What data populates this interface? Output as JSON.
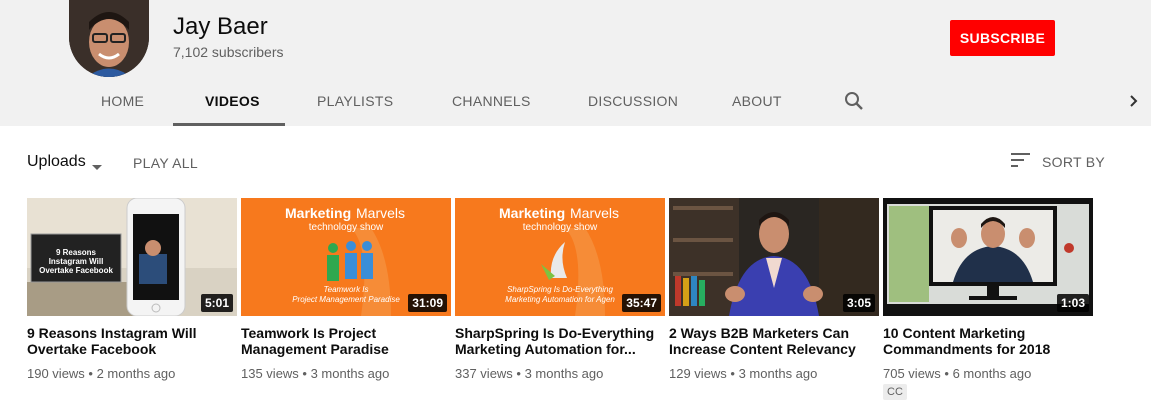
{
  "channel": {
    "name": "Jay Baer",
    "subscribers": "7,102 subscribers",
    "subscribe_label": "SUBSCRIBE"
  },
  "tabs": [
    "HOME",
    "VIDEOS",
    "PLAYLISTS",
    "CHANNELS",
    "DISCUSSION",
    "ABOUT"
  ],
  "active_tab": "VIDEOS",
  "toolbar": {
    "uploads_label": "Uploads",
    "play_all_label": "PLAY ALL",
    "sort_label": "SORT BY"
  },
  "thumb_text": {
    "brand_a": "Marketing",
    "brand_b": "Marvels",
    "show": "technology show",
    "insta_1": "9 Reasons",
    "insta_2": "Instagram Will",
    "insta_3": "Overtake Facebook",
    "v2_line1": "Teamwork Is",
    "v2_line2": "Project Management Paradise",
    "v3_line1": "SharpSpring Is Do-Everything",
    "v3_line2": "Marketing Automation for Agen"
  },
  "videos": [
    {
      "title": "9 Reasons Instagram Will Overtake Facebook",
      "views": "190 views",
      "age": "2 months ago",
      "duration": "5:01"
    },
    {
      "title": "Teamwork Is Project Management Paradise",
      "views": "135 views",
      "age": "3 months ago",
      "duration": "31:09"
    },
    {
      "title": "SharpSpring Is Do-Everything Marketing Automation for...",
      "views": "337 views",
      "age": "3 months ago",
      "duration": "35:47"
    },
    {
      "title": "2 Ways B2B Marketers Can Increase Content Relevancy",
      "views": "129 views",
      "age": "3 months ago",
      "duration": "3:05"
    },
    {
      "title": "10 Content Marketing Commandments for 2018",
      "views": "705 views",
      "age": "6 months ago",
      "duration": "1:03",
      "badge": "CC"
    }
  ],
  "colors": {
    "subscribe": "#ff0000",
    "header_bg": "#f1f1f1",
    "orange_thumb": "#f7791d"
  }
}
